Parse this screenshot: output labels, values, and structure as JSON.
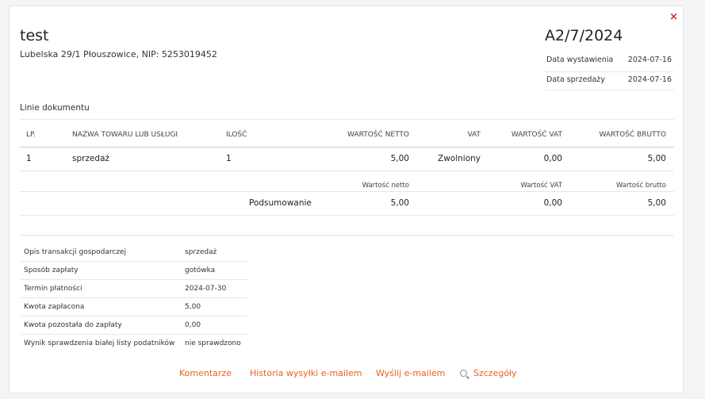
{
  "header": {
    "close_symbol": "×",
    "title": "test",
    "address": "Lubelska 29/1 Płouszowice, NIP: 5253019452",
    "doc_number": "A2/7/2024",
    "issue_date_label": "Data wystawienia",
    "issue_date": "2024-07-16",
    "sale_date_label": "Data sprzedaży",
    "sale_date": "2024-07-16"
  },
  "lines": {
    "section_label": "Linie dokumentu",
    "columns": {
      "lp": "LP.",
      "name": "NAZWA TOWARU LUB USŁUGI",
      "qty": "ILOŚĆ",
      "net": "WARTOŚĆ NETTO",
      "vat": "VAT",
      "vat_value": "WARTOŚĆ VAT",
      "gross": "WARTOŚĆ BRUTTO"
    },
    "rows": [
      {
        "lp": "1",
        "name": "sprzedaż",
        "qty": "1",
        "net": "5,00",
        "vat": "Zwolniony",
        "vat_value": "0,00",
        "gross": "5,00"
      }
    ]
  },
  "summary": {
    "net_label": "Wartość netto",
    "vat_label": "Wartość VAT",
    "gross_label": "Wartość brutto",
    "row_label": "Podsumowanie",
    "net": "5,00",
    "vat": "0,00",
    "gross": "5,00"
  },
  "info": [
    {
      "key": "Opis transakcji gospodarczej",
      "value": "sprzedaż"
    },
    {
      "key": "Sposób zapłaty",
      "value": "gotówka"
    },
    {
      "key": "Termin płatności",
      "value": "2024-07-30"
    },
    {
      "key": "Kwota zapłacona",
      "value": "5,00"
    },
    {
      "key": "Kwota pozostała do zapłaty",
      "value": "0,00"
    },
    {
      "key": "Wynik sprawdzenia białej listy podatników",
      "value": "nie sprawdzono"
    }
  ],
  "actions": {
    "comments": "Komentarze",
    "email_history": "Historia wysyłki e-mailem",
    "send_email": "Wyślij e-mailem",
    "details": "Szczegóły",
    "details_icon": "search-icon",
    "accent_color": "#e8631c",
    "close_color": "#dd2222"
  }
}
